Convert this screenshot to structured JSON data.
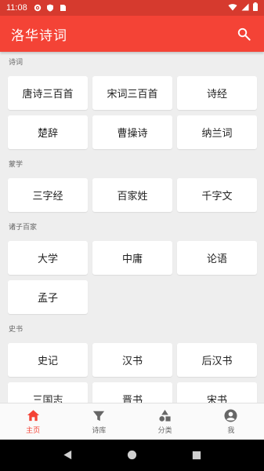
{
  "status_bar": {
    "time": "11:08",
    "icons": [
      "settings-icon",
      "shield-icon",
      "sim-card-icon",
      "wifi-icon",
      "signal-icon",
      "battery-icon"
    ]
  },
  "app_bar": {
    "title": "洛华诗词",
    "search_icon": "search-icon"
  },
  "colors": {
    "primary": "#f44336",
    "status_bar": "#d63a2e",
    "background": "#eeeeee",
    "active_nav": "#f44336"
  },
  "sections": [
    {
      "title": "诗词",
      "items": [
        "唐诗三百首",
        "宋词三百首",
        "诗经",
        "楚辞",
        "曹操诗",
        "纳兰词"
      ]
    },
    {
      "title": "蒙学",
      "items": [
        "三字经",
        "百家姓",
        "千字文"
      ]
    },
    {
      "title": "诸子百家",
      "items": [
        "大学",
        "中庸",
        "论语",
        "孟子"
      ]
    },
    {
      "title": "史书",
      "items": [
        "史记",
        "汉书",
        "后汉书",
        "三国志",
        "晋书",
        "宋书"
      ]
    }
  ],
  "bottom_nav": [
    {
      "label": "主页",
      "icon": "home-icon",
      "active": true
    },
    {
      "label": "诗库",
      "icon": "filter-icon",
      "active": false
    },
    {
      "label": "分类",
      "icon": "category-icon",
      "active": false
    },
    {
      "label": "我",
      "icon": "account-icon",
      "active": false
    }
  ],
  "system_nav": [
    "back-icon",
    "home-circle-icon",
    "recents-icon"
  ]
}
